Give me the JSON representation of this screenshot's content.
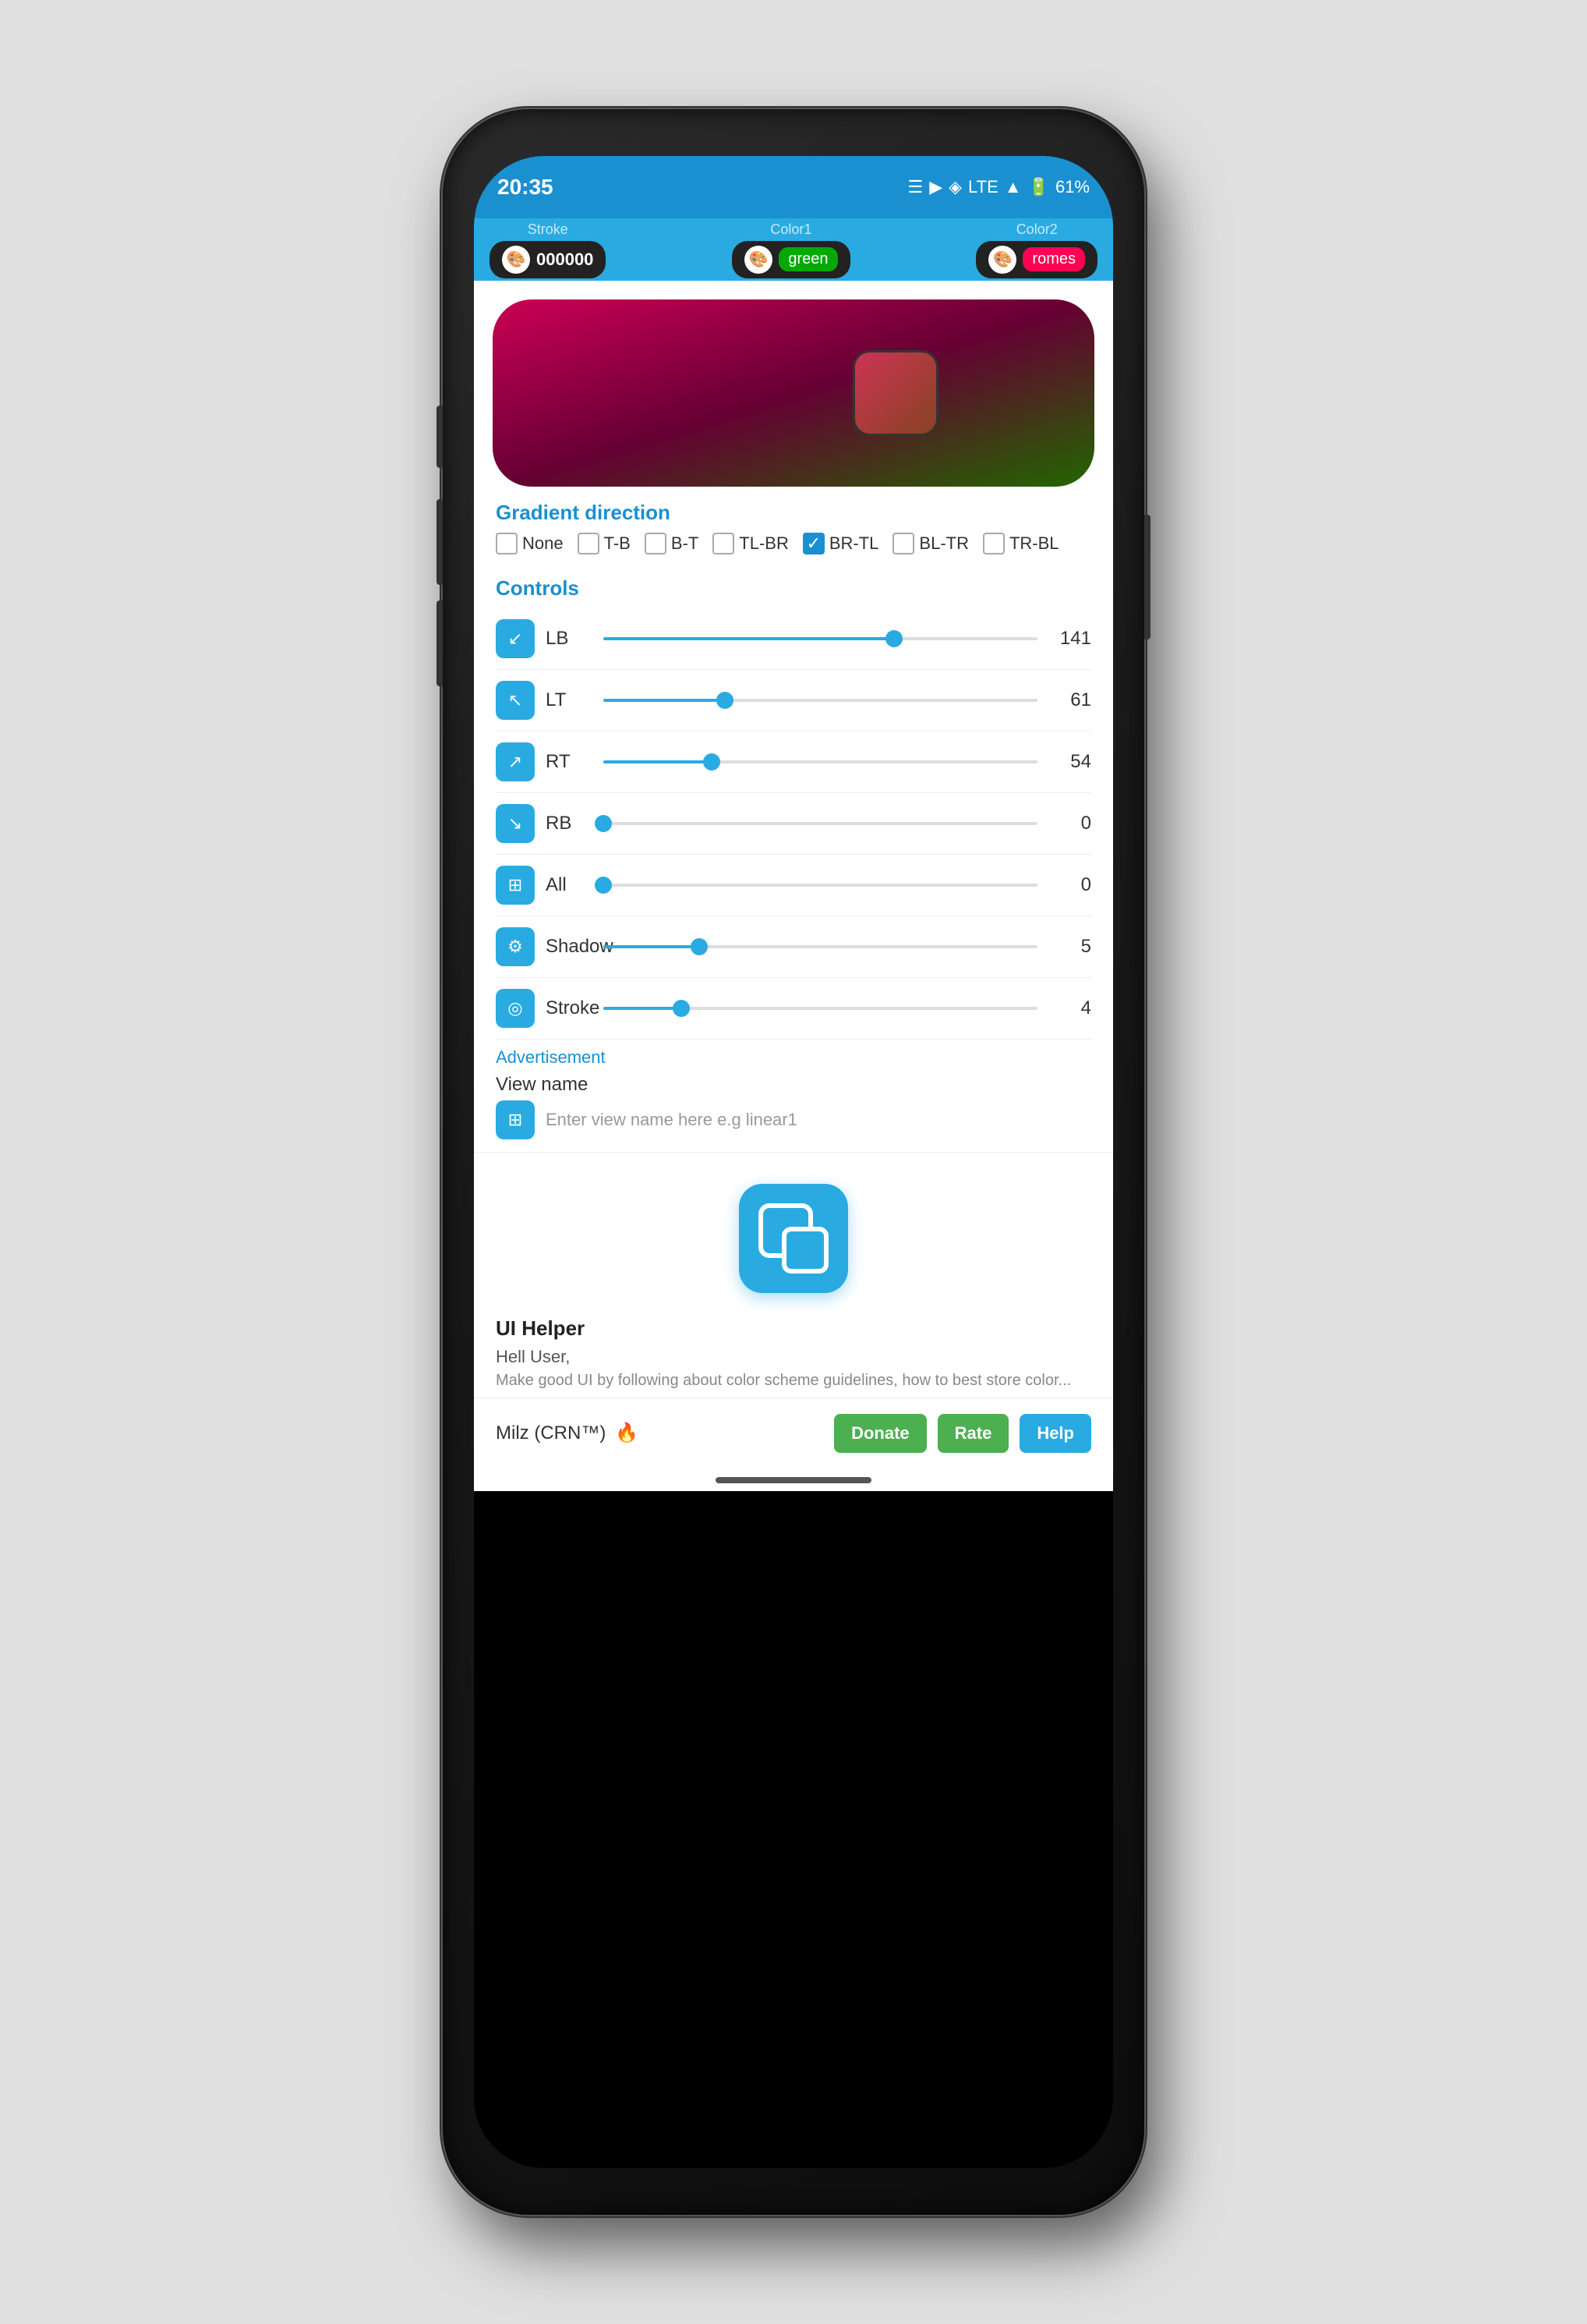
{
  "phone": {
    "status_bar": {
      "time": "20:35",
      "battery": "61%",
      "network": "LTE"
    },
    "top_bar": {
      "stroke_label": "Stroke",
      "stroke_value": "000000",
      "color1_label": "Color1",
      "color1_value": "green",
      "color2_label": "Color2",
      "color2_value": "romes"
    },
    "gradient_direction": {
      "label": "Gradient direction",
      "options": [
        "None",
        "T-B",
        "B-T",
        "TL-BR",
        "BR-TL",
        "BL-TR",
        "TR-BL"
      ],
      "selected": "BR-TL"
    },
    "controls": {
      "label": "Controls",
      "sliders": [
        {
          "id": "LB",
          "value": 141,
          "percent": 67
        },
        {
          "id": "LT",
          "value": 61,
          "percent": 28
        },
        {
          "id": "RT",
          "value": 54,
          "percent": 25
        },
        {
          "id": "RB",
          "value": 0,
          "percent": 0
        },
        {
          "id": "All",
          "value": 0,
          "percent": 0
        },
        {
          "id": "Shadow",
          "value": 5,
          "percent": 22
        },
        {
          "id": "Stroke",
          "value": 4,
          "percent": 18
        }
      ]
    },
    "advertisement": {
      "label": "Advertisement",
      "view_name_label": "View name",
      "view_name_placeholder": "Enter view name here e.g linear1"
    },
    "ui_helper": {
      "title": "UI Helper",
      "greeting": "Hell User,",
      "subtext": "Make good UI by following about color scheme guidelines, how to best store color..."
    },
    "branding": {
      "name": "Milz (CRN™)",
      "emoji": "🔥"
    },
    "buttons": {
      "donate": "Donate",
      "rate": "Rate",
      "help": "Help"
    }
  }
}
